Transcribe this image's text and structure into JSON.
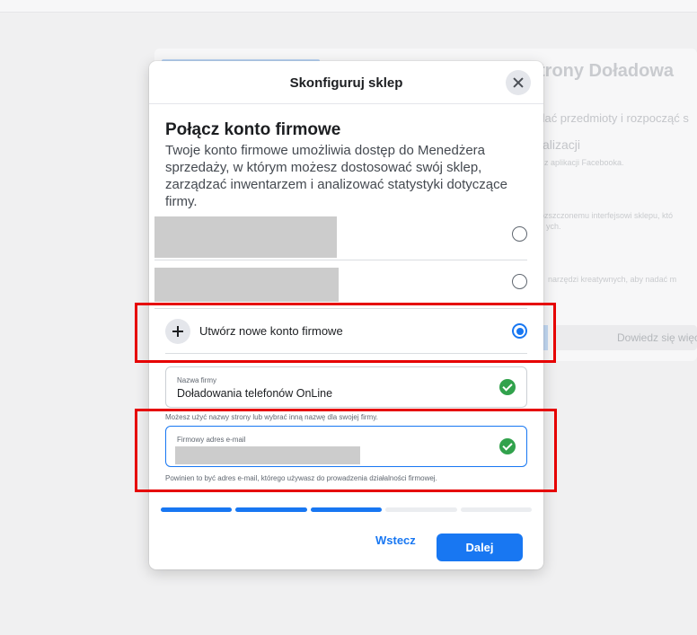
{
  "background": {
    "title": "trony Doładowa",
    "line1": "odać przedmioty i rozpocząć s",
    "line2": "alizacji",
    "line3": "z aplikacji Facebooka.",
    "line4": "rozszczonemu interfejsowi sklepu, któ",
    "line5": "ych.",
    "line6": "narzędzi kreatywnych, aby nadać m",
    "button": "Dowiedz się więc"
  },
  "modal": {
    "title": "Skonfiguruj sklep",
    "heading": "Połącz konto firmowe",
    "description": "Twoje konto firmowe umożliwia dostęp do Menedżera sprzedaży, w którym możesz dostosować swój sklep, zarządzać inwentarzem i analizować statystyki dotyczące firmy.",
    "create_account_label": "Utwórz nowe konto firmowe",
    "business_name_field": {
      "label": "Nazwa firmy",
      "value": "Doładowania telefonów OnLine",
      "hint": "Możesz użyć nazwy strony lub wybrać inną nazwę dla swojej firmy."
    },
    "business_email_field": {
      "label": "Firmowy adres e-mail",
      "hint": "Powinien to być adres e-mail, którego używasz do prowadzenia działalności firmowej."
    },
    "progress": {
      "total_steps": 5,
      "completed_steps": 3
    },
    "back_label": "Wstecz",
    "next_label": "Dalej"
  },
  "colors": {
    "accent": "#1877f2",
    "success": "#31a24c",
    "annotation": "#e60000"
  }
}
